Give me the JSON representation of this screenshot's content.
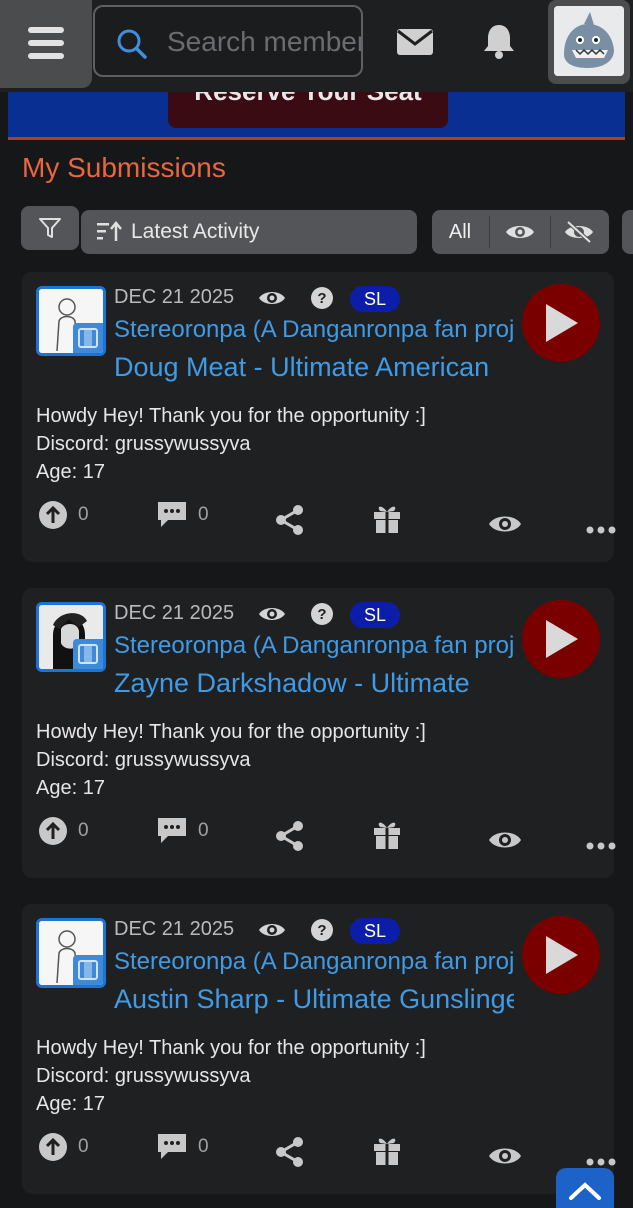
{
  "header": {
    "search_placeholder": "Search members",
    "menu_icon": "hamburger-icon",
    "mail_icon": "mail-icon",
    "bell_icon": "bell-icon"
  },
  "banner": {
    "button_label": "Reserve Your Seat"
  },
  "section": {
    "title": "My Submissions",
    "sort_label": "Latest Activity",
    "visibility_all": "All"
  },
  "submissions": [
    {
      "date": "DEC 21 2025",
      "badge": "SL",
      "project": "Stereoronpa (A Danganronpa fan project)",
      "role": "Doug Meat - Ultimate American",
      "description": [
        "Howdy Hey! Thank you for the opportunity :]",
        "Discord: grussywussyva",
        "Age: 17"
      ],
      "upvotes": "0",
      "comments": "0"
    },
    {
      "date": "DEC 21 2025",
      "badge": "SL",
      "project": "Stereoronpa (A Danganronpa fan project)",
      "role": "Zayne Darkshadow - Ultimate",
      "description": [
        "Howdy Hey! Thank you for the opportunity :]",
        "Discord: grussywussyva",
        "Age: 17"
      ],
      "upvotes": "0",
      "comments": "0"
    },
    {
      "date": "DEC 21 2025",
      "badge": "SL",
      "project": "Stereoronpa (A Danganronpa fan project)",
      "role": "Austin Sharp - Ultimate Gunslinger",
      "description": [
        "Howdy Hey! Thank you for the opportunity :]",
        "Discord: grussywussyva",
        "Age: 17"
      ],
      "upvotes": "0",
      "comments": "0"
    }
  ],
  "colors": {
    "accent": "#e9663f",
    "link": "#3f9be6",
    "badge": "#0c1ea9",
    "play": "#7a0000"
  }
}
